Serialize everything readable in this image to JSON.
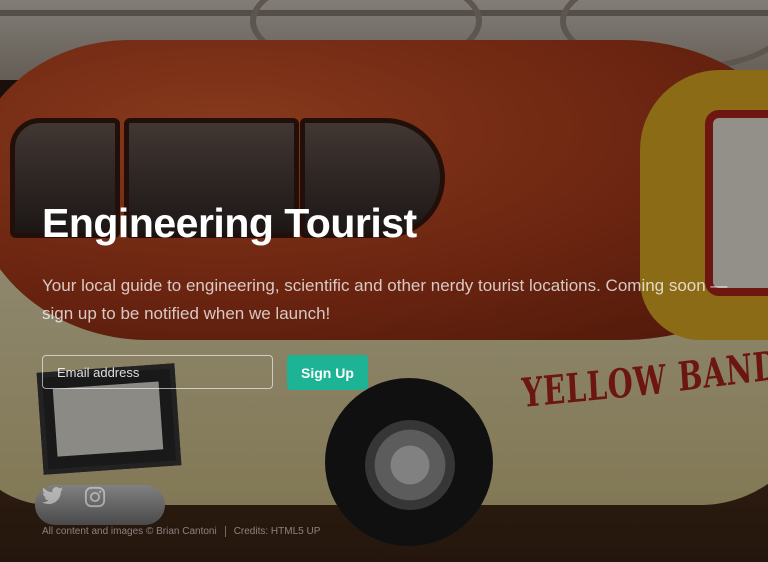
{
  "hero": {
    "title": "Engineering Tourist",
    "tagline": "Your local guide to engineering, scientific and other nerdy tourist locations. Coming soon — sign up to be notified when we launch!"
  },
  "signup": {
    "email_placeholder": "Email address",
    "button_label": "Sign Up"
  },
  "social": {
    "icons": [
      "twitter-icon",
      "instagram-icon"
    ]
  },
  "footer": {
    "copyright": "All content and images © Brian Cantoni",
    "credits": "Credits: HTML5 UP"
  },
  "background": {
    "bun_text_left": "YELLOW",
    "bun_text_right": "BAND"
  },
  "colors": {
    "accent": "#1cb495",
    "title": "#ffffff",
    "overlay": "rgba(0,0,0,0.40)"
  }
}
